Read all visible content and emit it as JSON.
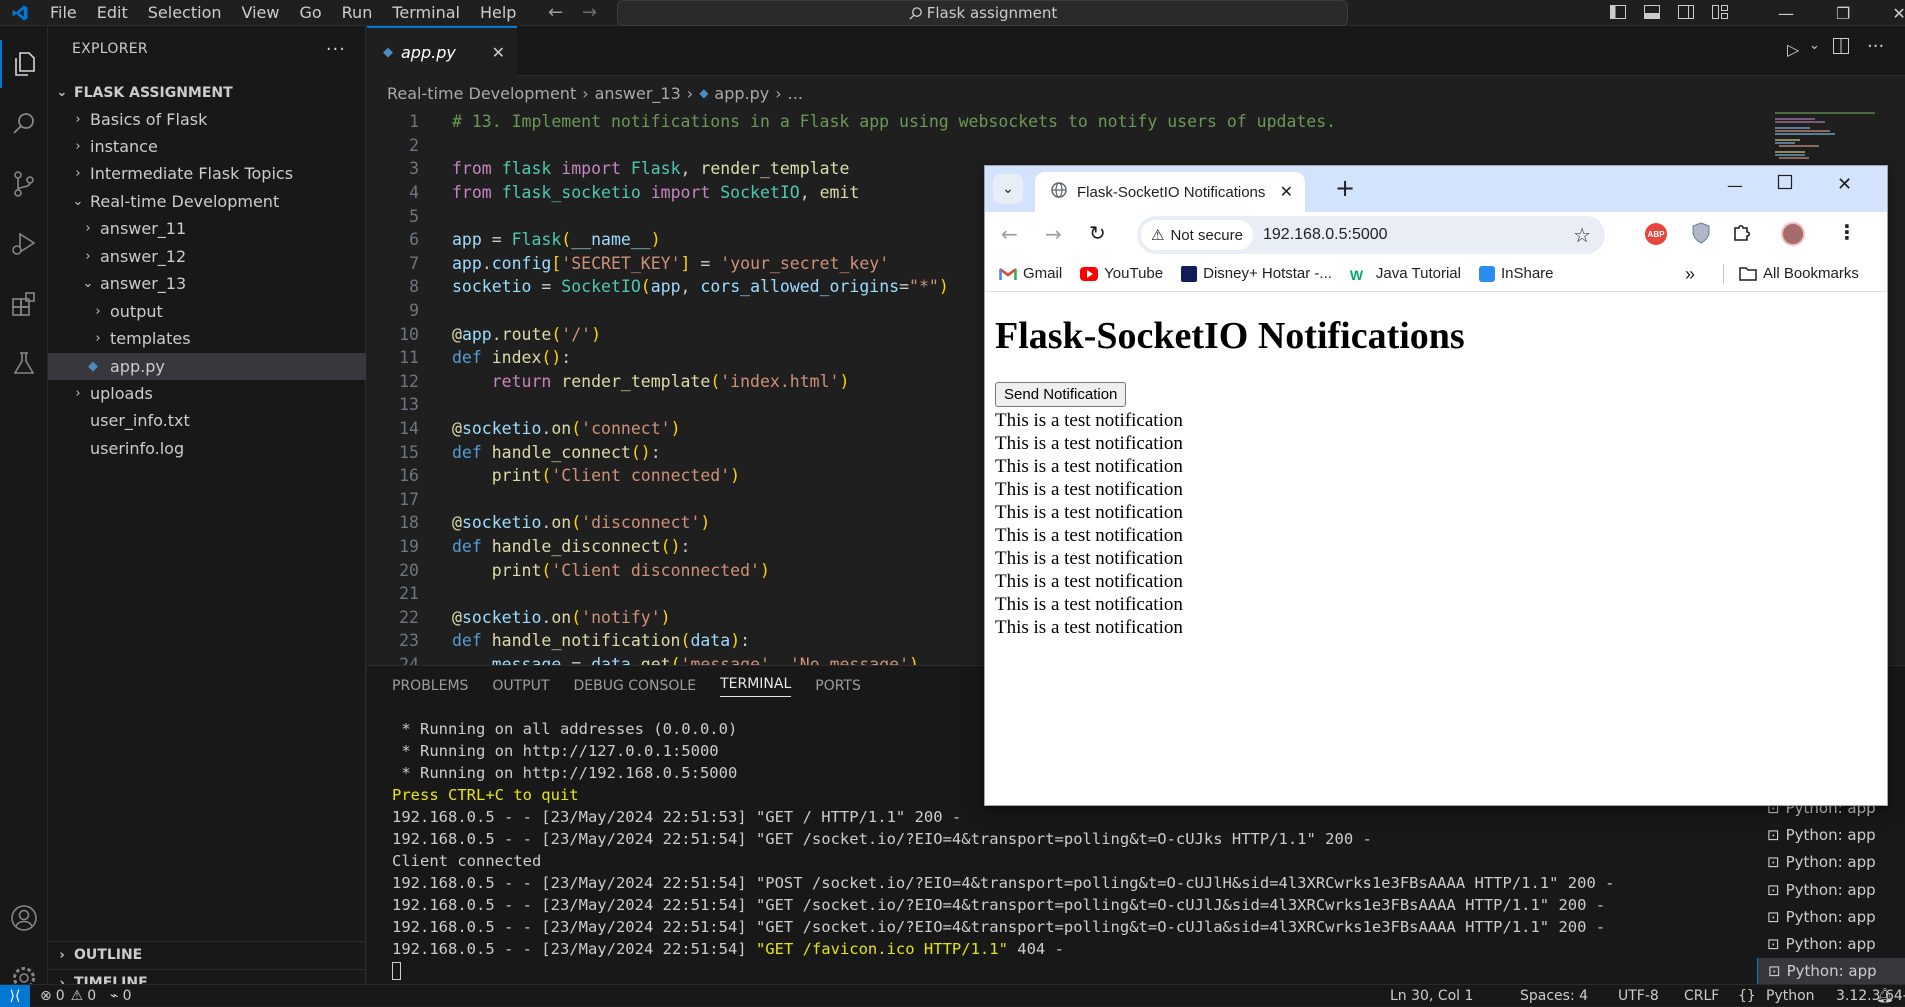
{
  "titlebar": {
    "menu": [
      "File",
      "Edit",
      "Selection",
      "View",
      "Go",
      "Run",
      "Terminal",
      "Help"
    ],
    "search": "Flask assignment"
  },
  "explorer": {
    "header": "EXPLORER",
    "root": "FLASK ASSIGNMENT",
    "items": [
      {
        "label": "Basics of Flask",
        "chev": "›"
      },
      {
        "label": "instance",
        "chev": "›"
      },
      {
        "label": "Intermediate Flask Topics",
        "chev": "›"
      },
      {
        "label": "Real-time Development",
        "chev": "⌄"
      },
      {
        "label": "answer_11",
        "chev": "›"
      },
      {
        "label": "answer_12",
        "chev": "›"
      },
      {
        "label": "answer_13",
        "chev": "⌄"
      },
      {
        "label": "output",
        "chev": "›"
      },
      {
        "label": "templates",
        "chev": "›"
      },
      {
        "label": "app.py",
        "chev": ""
      },
      {
        "label": "uploads",
        "chev": "›"
      },
      {
        "label": "user_info.txt",
        "chev": ""
      },
      {
        "label": "userinfo.log",
        "chev": ""
      }
    ],
    "outline": "OUTLINE",
    "timeline": "TIMELINE"
  },
  "editor": {
    "tab": "app.py",
    "breadcrumb": [
      "Real-time Development",
      "answer_13",
      "app.py",
      "..."
    ],
    "line_numbers": [
      "1",
      "2",
      "3",
      "4",
      "5",
      "6",
      "7",
      "8",
      "9",
      "10",
      "11",
      "12",
      "13",
      "14",
      "15",
      "16",
      "17",
      "18",
      "19",
      "20",
      "21",
      "22",
      "23",
      "24"
    ]
  },
  "panel": {
    "tabs": [
      "PROBLEMS",
      "OUTPUT",
      "DEBUG CONSOLE",
      "TERMINAL",
      "PORTS"
    ],
    "terminal_lines": [
      " * Running on all addresses (0.0.0.0)",
      " * Running on http://127.0.0.1:5000",
      " * Running on http://192.168.0.5:5000",
      "Press CTRL+C to quit",
      "192.168.0.5 - - [23/May/2024 22:51:53] \"GET / HTTP/1.1\" 200 -",
      "192.168.0.5 - - [23/May/2024 22:51:54] \"GET /socket.io/?EIO=4&transport=polling&t=O-cUJks HTTP/1.1\" 200 -",
      "Client connected",
      "192.168.0.5 - - [23/May/2024 22:51:54] \"POST /socket.io/?EIO=4&transport=polling&t=O-cUJlH&sid=4l3XRCwrks1e3FBsAAAA HTTP/1.1\" 200 -",
      "192.168.0.5 - - [23/May/2024 22:51:54] \"GET /socket.io/?EIO=4&transport=polling&t=O-cUJlJ&sid=4l3XRCwrks1e3FBsAAAA HTTP/1.1\" 200 -",
      "192.168.0.5 - - [23/May/2024 22:51:54] \"GET /socket.io/?EIO=4&transport=polling&t=O-cUJla&sid=4l3XRCwrks1e3FBsAAAA HTTP/1.1\" 200 -"
    ],
    "favicon_prefix": "192.168.0.5 - - [23/May/2024 22:51:54] ",
    "favicon_req": "\"GET /favicon.ico HTTP/1.1\"",
    "favicon_suffix": " 404 -",
    "terminals": [
      "Python: app",
      "Python: app",
      "Python: app",
      "Python: app",
      "Python: app",
      "Python: app",
      "Python: app",
      "Python: app"
    ]
  },
  "status": {
    "errors": "0",
    "warnings": "0",
    "ports": "0",
    "position": "Ln 30, Col 1",
    "spaces": "Spaces: 4",
    "encoding": "UTF-8",
    "eol": "CRLF",
    "language": "Python",
    "interpreter": "3.12.3 64-bit"
  },
  "browser": {
    "tab_title": "Flask-SocketIO Notifications",
    "security": "Not secure",
    "url": "192.168.0.5:5000",
    "bookmarks": [
      "Gmail",
      "YouTube",
      "Disney+ Hotstar -...",
      "Java Tutorial",
      "InShare"
    ],
    "all_bookmarks": "All Bookmarks",
    "page_heading": "Flask-SocketIO Notifications",
    "button": "Send Notification",
    "notifications": [
      "This is a test notification",
      "This is a test notification",
      "This is a test notification",
      "This is a test notification",
      "This is a test notification",
      "This is a test notification",
      "This is a test notification",
      "This is a test notification",
      "This is a test notification",
      "This is a test notification"
    ]
  }
}
